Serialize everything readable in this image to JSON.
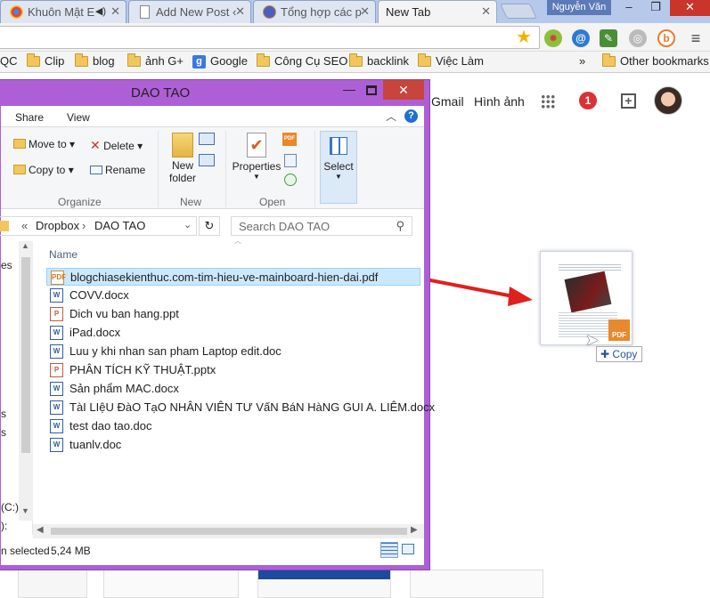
{
  "browser": {
    "tabs": [
      {
        "title": "Khuôn Mật E",
        "active": false
      },
      {
        "title": "Add New Post ‹",
        "active": false
      },
      {
        "title": "Tổng hợp các p",
        "active": false
      },
      {
        "title": "New Tab",
        "active": true
      }
    ],
    "user_name": "Nguyễn Văn",
    "window_controls": {
      "minimize": "–",
      "restore": "❐",
      "close": "✕"
    }
  },
  "bookmarks": {
    "items": [
      "QC",
      "Clip",
      "blog",
      "ảnh G+",
      "Google",
      "Công Cụ SEO",
      "backlink",
      "Việc Làm"
    ],
    "overflow": "»",
    "other": "Other bookmarks"
  },
  "google_bar": {
    "gmail": "Gmail",
    "images": "Hình ảnh",
    "notification_count": "1"
  },
  "explorer": {
    "title": "DAO TAO",
    "ribbon_tabs": [
      "Share",
      "View"
    ],
    "ribbon": {
      "move_to": "Move to",
      "copy_to": "Copy to",
      "delete": "Delete",
      "rename": "Rename",
      "organize": "Organize",
      "new_folder_1": "New",
      "new_folder_2": "folder",
      "new_group": "New",
      "properties": "Properties",
      "open_group": "Open",
      "select": "Select"
    },
    "address": {
      "prefix": "«",
      "path": [
        "Dropbox",
        "DAO TAO"
      ],
      "separator": "›"
    },
    "search_placeholder": "Search DAO TAO",
    "nav_fragments": [
      "es",
      "s",
      "s",
      "(C:)",
      "):"
    ],
    "column_name": "Name",
    "files": [
      {
        "name": "blogchiasekienthuc.com-tim-hieu-ve-mainboard-hien-dai.pdf",
        "type": "pdf",
        "selected": true
      },
      {
        "name": "COVV.docx",
        "type": "doc",
        "selected": false
      },
      {
        "name": "Dich vu ban hang.ppt",
        "type": "ppt",
        "selected": false
      },
      {
        "name": "iPad.docx",
        "type": "doc",
        "selected": false
      },
      {
        "name": "Luu y khi nhan san pham Laptop edit.doc",
        "type": "doc",
        "selected": false
      },
      {
        "name": "PHÂN TÍCH KỸ THUẬT.pptx",
        "type": "ppt",
        "selected": false
      },
      {
        "name": "Sản phẩm MAC.docx",
        "type": "doc",
        "selected": false
      },
      {
        "name": "TàI LIệU ĐàO TạO NHÂN VIÊN TƯ VấN BáN HàNG GUI A. LIÊM.docx",
        "type": "doc",
        "selected": false
      },
      {
        "name": "test dao tao.doc",
        "type": "doc",
        "selected": false
      },
      {
        "name": "tuanlv.doc",
        "type": "doc",
        "selected": false
      }
    ],
    "status": {
      "selected_text": "n selected",
      "size": "5,24 MB"
    }
  },
  "drag": {
    "copy_label": "Copy",
    "pdf_badge": "PDF"
  },
  "colors": {
    "explorer_frame": "#ae5fd6",
    "selection": "#cce8ff",
    "arrow": "#e0201c"
  }
}
